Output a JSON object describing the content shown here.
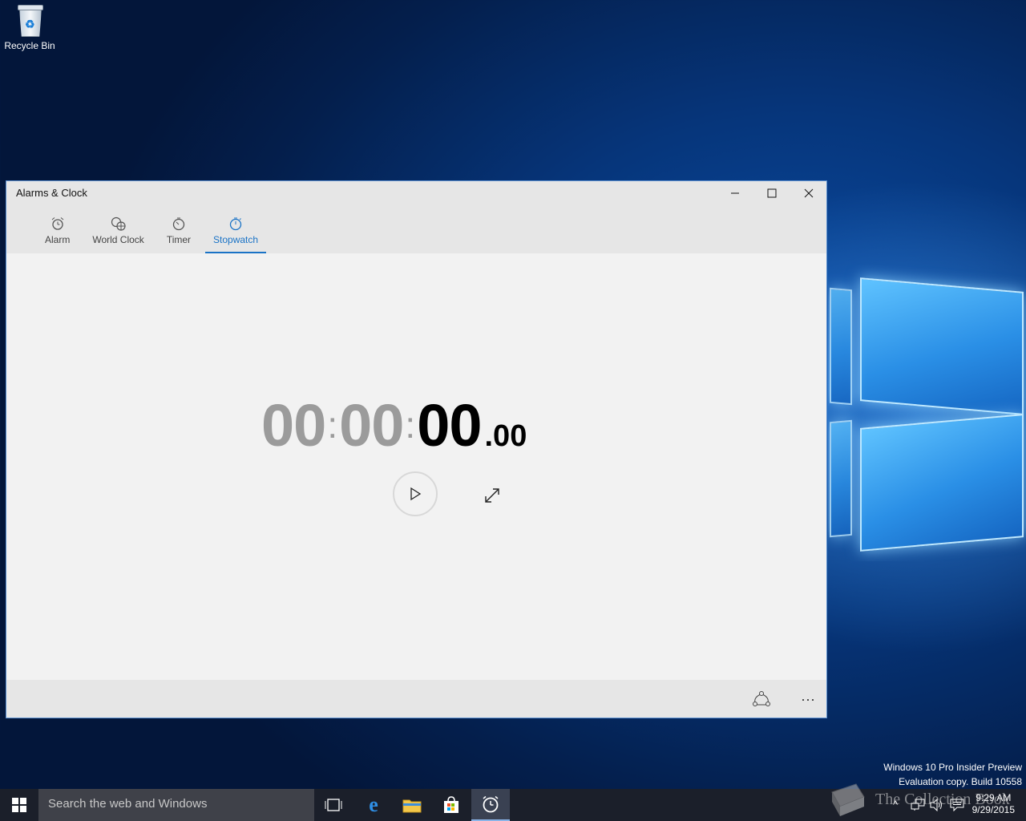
{
  "desktop": {
    "recycle_bin_label": "Recycle Bin",
    "watermark_line1": "Windows 10 Pro Insider Preview",
    "watermark_line2": "Evaluation copy. Build 10558"
  },
  "window": {
    "title": "Alarms & Clock",
    "tabs": [
      {
        "label": "Alarm",
        "icon": "alarm-clock-icon"
      },
      {
        "label": "World Clock",
        "icon": "world-clock-icon"
      },
      {
        "label": "Timer",
        "icon": "timer-icon"
      },
      {
        "label": "Stopwatch",
        "icon": "stopwatch-icon",
        "active": true
      }
    ],
    "stopwatch": {
      "hours": "00",
      "minutes": "00",
      "seconds": "00",
      "centiseconds": ".00"
    }
  },
  "taskbar": {
    "search_placeholder": "Search the web and Windows",
    "time": "9:29 AM",
    "date": "9/29/2015",
    "overlay_text": "The Collection Book"
  },
  "colors": {
    "accent": "#1a73c6",
    "taskbar": "#1b1f2a"
  }
}
